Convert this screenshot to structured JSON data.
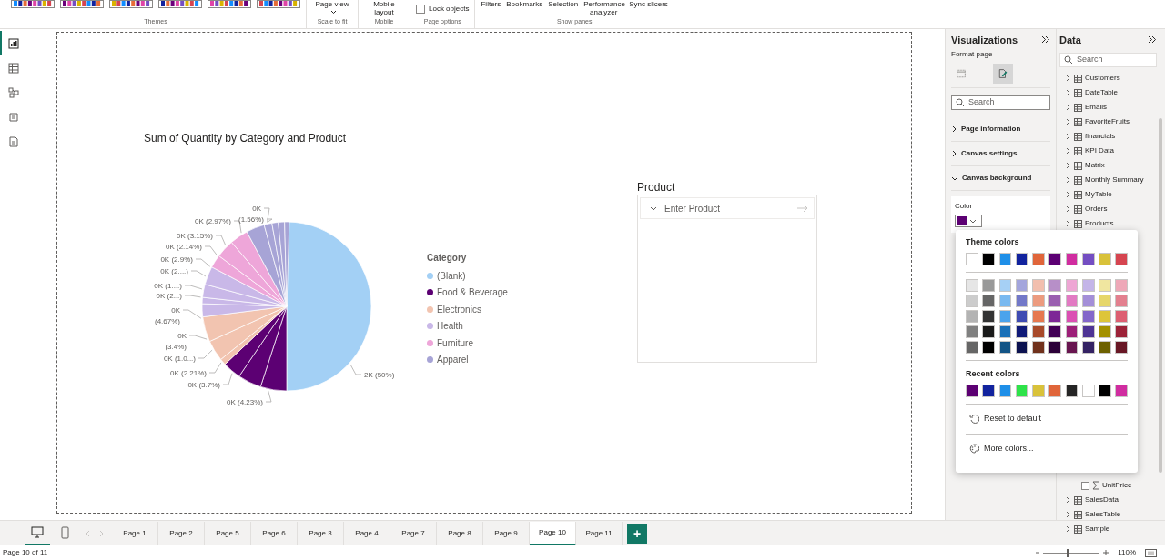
{
  "ribbon": {
    "groups": [
      {
        "label": "Themes",
        "kind": "themes"
      },
      {
        "label": "Scale to fit",
        "kind": "buttons",
        "buttons": [
          {
            "label": "Page view",
            "dropdown": true
          }
        ]
      },
      {
        "label": "Mobile",
        "kind": "buttons",
        "buttons": [
          {
            "label": "Mobile layout",
            "dropdown": false
          }
        ]
      },
      {
        "label": "Page options",
        "kind": "checkbox",
        "checkbox": {
          "label": "Lock objects",
          "checked": false
        }
      },
      {
        "label": "Show panes",
        "kind": "buttons",
        "buttons": [
          {
            "label": "Filters",
            "dropdown": false
          },
          {
            "label": "Bookmarks",
            "dropdown": false
          },
          {
            "label": "Selection",
            "dropdown": false
          },
          {
            "label": "Performance analyzer",
            "dropdown": false
          },
          {
            "label": "Sync slicers",
            "dropdown": false
          }
        ]
      }
    ]
  },
  "left_rail": [
    {
      "kind": "report",
      "selected": true
    },
    {
      "kind": "table",
      "selected": false
    },
    {
      "kind": "model",
      "selected": false
    },
    {
      "kind": "dax",
      "selected": false
    },
    {
      "kind": "query",
      "selected": false
    }
  ],
  "canvas": {
    "chart": {
      "title": "Sum of Quantity by Category and Product",
      "pie_labels": [
        {
          "lines": [
            "0K"
          ]
        },
        {
          "lines": [
            "0K (2.97%)"
          ]
        },
        {
          "lines": [
            "(1.56%)"
          ]
        },
        {
          "lines": [
            "0K (3.15%)"
          ]
        },
        {
          "lines": [
            "0K (2.14%)"
          ]
        },
        {
          "lines": [
            "0K (2.9%)"
          ]
        },
        {
          "lines": [
            "0K (2....)"
          ]
        },
        {
          "lines": [
            "0K (1....)"
          ]
        },
        {
          "lines": [
            "0K (2...)"
          ]
        },
        {
          "lines": [
            "0K",
            "(4.67%)"
          ]
        },
        {
          "lines": [
            "0K",
            "(3.4%)"
          ]
        },
        {
          "lines": [
            "0K (1.0...)"
          ]
        },
        {
          "lines": [
            "0K (2.21%)"
          ]
        },
        {
          "lines": [
            "0K (3.7%)"
          ]
        },
        {
          "lines": [
            "0K (4.23%)"
          ]
        },
        {
          "lines": [
            "2K (50%)"
          ]
        }
      ],
      "legend": {
        "title": "Category",
        "items": [
          {
            "label": "(Blank)",
            "color": "#a3d0f5"
          },
          {
            "label": "Food & Beverage",
            "color": "#5c0073"
          },
          {
            "label": "Electronics",
            "color": "#f2c4b0"
          },
          {
            "label": "Health",
            "color": "#c9b8e8"
          },
          {
            "label": "Furniture",
            "color": "#eea6d9"
          },
          {
            "label": "Apparel",
            "color": "#a7a4d6"
          }
        ]
      }
    },
    "slicer": {
      "title": "Product",
      "placeholder": "Enter Product"
    }
  },
  "visualizations": {
    "title": "Visualizations",
    "subtitle": "Format page",
    "modes": [
      {
        "kind": "build",
        "selected": false
      },
      {
        "kind": "format",
        "selected": true
      }
    ],
    "search": {
      "placeholder": "Search"
    },
    "sections": [
      {
        "label": "Page information",
        "expanded": false
      },
      {
        "label": "Canvas settings",
        "expanded": false
      },
      {
        "label": "Canvas background",
        "expanded": true
      }
    ],
    "color_field": {
      "label": "Color",
      "color": "#5c0073"
    }
  },
  "data": {
    "title": "Data",
    "search": {
      "placeholder": "Search"
    },
    "items": [
      {
        "kind": "table",
        "name": "Customers",
        "expanded": false
      },
      {
        "kind": "table",
        "name": "DateTable",
        "expanded": false
      },
      {
        "kind": "table",
        "name": "Emails",
        "expanded": false
      },
      {
        "kind": "table",
        "name": "FavoriteFruits",
        "expanded": false
      },
      {
        "kind": "table",
        "name": "financials",
        "expanded": false
      },
      {
        "kind": "table",
        "name": "KPI Data",
        "expanded": false
      },
      {
        "kind": "table",
        "name": "Matrix",
        "expanded": false
      },
      {
        "kind": "table",
        "name": "Monthly Summary",
        "expanded": false
      },
      {
        "kind": "table",
        "name": "MyTable",
        "expanded": false
      },
      {
        "kind": "table",
        "name": "Orders",
        "expanded": false
      },
      {
        "kind": "table",
        "name": "Products",
        "expanded": false
      },
      {
        "kind": "field",
        "name": "UnitPrice",
        "checked": false
      },
      {
        "kind": "table",
        "name": "SalesData",
        "expanded": false
      },
      {
        "kind": "table",
        "name": "SalesTable",
        "expanded": false
      },
      {
        "kind": "table",
        "name": "Sample",
        "expanded": false
      }
    ]
  },
  "color_picker": {
    "theme_title": "Theme colors",
    "theme": [
      {
        "color": "#ffffff"
      },
      {
        "color": "#000000"
      },
      {
        "color": "#1f8fe8"
      },
      {
        "color": "#12239e"
      },
      {
        "color": "#e0653a"
      },
      {
        "color": "#5c0073"
      },
      {
        "color": "#d02da0"
      },
      {
        "color": "#744ec2"
      },
      {
        "color": "#d9c23a"
      },
      {
        "color": "#d64550"
      }
    ],
    "shades": [
      [
        {
          "color": "#e6e6e6"
        },
        {
          "color": "#999999"
        },
        {
          "color": "#a6d0f5"
        },
        {
          "color": "#a3a5dc"
        },
        {
          "color": "#f2bfae"
        },
        {
          "color": "#b78fc8"
        },
        {
          "color": "#eea6d4"
        },
        {
          "color": "#c4b5e8"
        },
        {
          "color": "#f0e6a0"
        },
        {
          "color": "#eea8b8"
        }
      ],
      [
        {
          "color": "#cccccc"
        },
        {
          "color": "#666666"
        },
        {
          "color": "#79b9f0"
        },
        {
          "color": "#7278c8"
        },
        {
          "color": "#ec9b7f"
        },
        {
          "color": "#9a5fb0"
        },
        {
          "color": "#e27ac3"
        },
        {
          "color": "#a48fd8"
        },
        {
          "color": "#e6d66a"
        },
        {
          "color": "#e3808f"
        }
      ],
      [
        {
          "color": "#b3b3b3"
        },
        {
          "color": "#333333"
        },
        {
          "color": "#4ba3ec"
        },
        {
          "color": "#3f4bb2"
        },
        {
          "color": "#e6784f"
        },
        {
          "color": "#7d2796"
        },
        {
          "color": "#db50b3"
        },
        {
          "color": "#8467ca"
        },
        {
          "color": "#ddc53a"
        },
        {
          "color": "#dd5f72"
        }
      ],
      [
        {
          "color": "#808080"
        },
        {
          "color": "#1a1a1a"
        },
        {
          "color": "#1970b8"
        },
        {
          "color": "#101a78"
        },
        {
          "color": "#a84a2a"
        },
        {
          "color": "#420055"
        },
        {
          "color": "#9c1f78"
        },
        {
          "color": "#4e3494"
        },
        {
          "color": "#a39100"
        },
        {
          "color": "#9c2238"
        }
      ],
      [
        {
          "color": "#666666"
        },
        {
          "color": "#000000"
        },
        {
          "color": "#135486"
        },
        {
          "color": "#0c1250"
        },
        {
          "color": "#70311c"
        },
        {
          "color": "#2c0038"
        },
        {
          "color": "#681550"
        },
        {
          "color": "#342263"
        },
        {
          "color": "#6d6100"
        },
        {
          "color": "#681725"
        }
      ]
    ],
    "recent_title": "Recent colors",
    "recent": [
      {
        "color": "#5c0073"
      },
      {
        "color": "#12239e"
      },
      {
        "color": "#1f8fe8"
      },
      {
        "color": "#2ee34a"
      },
      {
        "color": "#d9c23a"
      },
      {
        "color": "#e0653a"
      },
      {
        "color": "#252525"
      },
      {
        "color": "#ffffff"
      },
      {
        "color": "#000000"
      },
      {
        "color": "#d02da0"
      }
    ],
    "actions": [
      {
        "kind": "reset",
        "label": "Reset to default"
      },
      {
        "kind": "more",
        "label": "More colors..."
      }
    ]
  },
  "page_tabs": {
    "views": [
      {
        "kind": "desktop",
        "selected": true
      },
      {
        "kind": "mobile",
        "selected": false
      }
    ],
    "tabs": [
      {
        "label": "Page 1",
        "selected": false
      },
      {
        "label": "Page 2",
        "selected": false
      },
      {
        "label": "Page 5",
        "selected": false
      },
      {
        "label": "Page 6",
        "selected": false
      },
      {
        "label": "Page 3",
        "selected": false
      },
      {
        "label": "Page 4",
        "selected": false
      },
      {
        "label": "Page 7",
        "selected": false
      },
      {
        "label": "Page 8",
        "selected": false
      },
      {
        "label": "Page 9",
        "selected": false
      },
      {
        "label": "Page 10",
        "selected": true
      },
      {
        "label": "Page 11",
        "selected": false
      }
    ],
    "add_button": "+"
  },
  "status_bar": {
    "page": "Page 10 of 11",
    "zoom": {
      "level": 0.41,
      "value": "110%"
    }
  }
}
